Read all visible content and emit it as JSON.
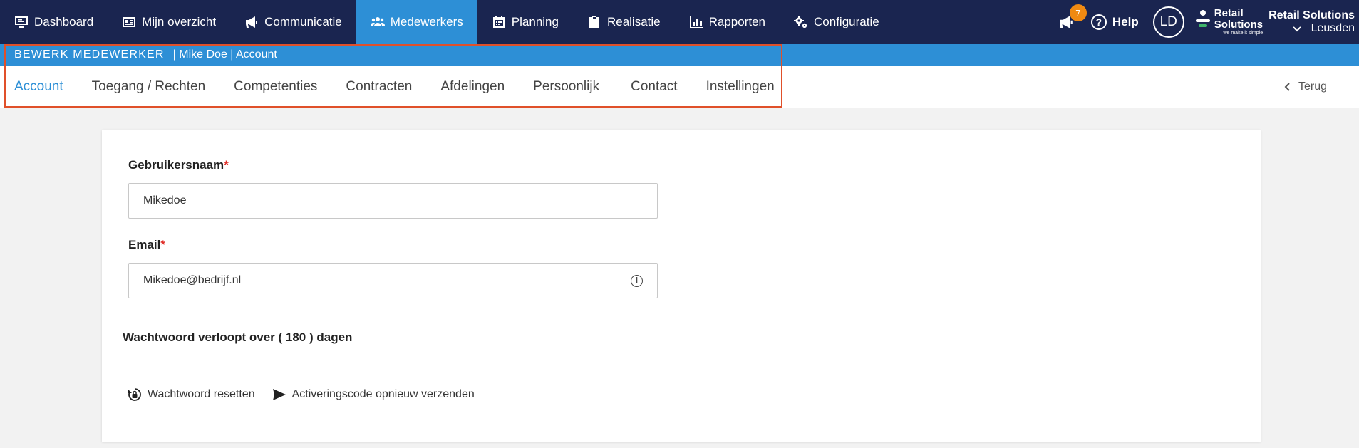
{
  "nav": {
    "items": [
      {
        "label": "Dashboard",
        "icon": "monitor-icon"
      },
      {
        "label": "Mijn overzicht",
        "icon": "id-card-icon"
      },
      {
        "label": "Communicatie",
        "icon": "megaphone-icon"
      },
      {
        "label": "Medewerkers",
        "icon": "users-icon"
      },
      {
        "label": "Planning",
        "icon": "calendar-icon"
      },
      {
        "label": "Realisatie",
        "icon": "clipboard-icon"
      },
      {
        "label": "Rapporten",
        "icon": "bar-chart-icon"
      },
      {
        "label": "Configuratie",
        "icon": "gears-icon"
      }
    ],
    "active": "Medewerkers",
    "notification_count": "7",
    "help_label": "Help",
    "avatar_initials": "LD",
    "logo_line1": "Retail",
    "logo_line2": "Solutions",
    "logo_tagline": "we make it simple",
    "org_name": "Retail Solutions",
    "location": "Leusden"
  },
  "subheader": {
    "section": "BEWERK MEDEWERKER",
    "breadcrumb": "| Mike Doe | Account"
  },
  "tabs": {
    "items": [
      "Account",
      "Toegang / Rechten",
      "Competenties",
      "Contracten",
      "Afdelingen",
      "Persoonlijk",
      "Contact",
      "Instellingen"
    ],
    "active": "Account",
    "back_label": "Terug"
  },
  "form": {
    "username_label": "Gebruikersnaam",
    "username_value": "Mikedoe",
    "email_label": "Email",
    "email_value": "Mikedoe@bedrijf.nl",
    "required_mark": "*",
    "expiry_text": "Wachtwoord verloopt over ( 180 ) dagen",
    "reset_label": "Wachtwoord resetten",
    "resend_label": "Activeringscode opnieuw verzenden"
  },
  "colors": {
    "navbar": "#1a2550",
    "accent": "#2d8fd6",
    "badge": "#f08a12",
    "highlight": "#e0502a",
    "required": "#e0302a"
  }
}
